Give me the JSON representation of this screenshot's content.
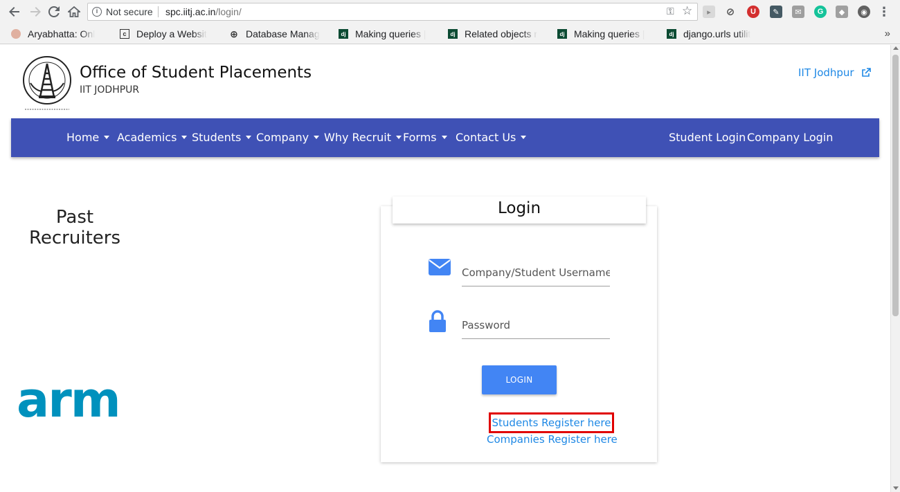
{
  "browser": {
    "security_label": "Not secure",
    "url_host": "spc.iitj.ac.in",
    "url_path": "/login/",
    "bookmarks": [
      {
        "label": "Aryabhatta: Onl",
        "icon": "aryabhatta-icon"
      },
      {
        "label": "Deploy a Websit",
        "icon": "document-icon"
      },
      {
        "label": "Database Manag",
        "icon": "globe-icon"
      },
      {
        "label": "Making queries |",
        "icon": "django-icon"
      },
      {
        "label": "Related objects r",
        "icon": "django-icon"
      },
      {
        "label": "Making queries |",
        "icon": "django-icon"
      },
      {
        "label": "django.urls utilit",
        "icon": "django-icon"
      }
    ],
    "more_bookmarks": "»"
  },
  "header": {
    "title": "Office of Student Placements",
    "subtitle": "IIT JODHPUR",
    "external_link": "IIT Jodhpur"
  },
  "nav": {
    "items": [
      {
        "label": "Home"
      },
      {
        "label": "Academics"
      },
      {
        "label": "Students"
      },
      {
        "label": "Company"
      },
      {
        "label": "Why Recruit"
      },
      {
        "label": "Forms"
      },
      {
        "label": "Contact Us"
      }
    ],
    "student_login": "Student Login",
    "company_login": "Company Login"
  },
  "sidebar": {
    "heading_line1": "Past",
    "heading_line2": "Recruiters",
    "recruiter_logo": "arm"
  },
  "login_card": {
    "title": "Login",
    "username_placeholder": "Company/Student Username",
    "password_placeholder": "Password",
    "login_button": "LOGIN",
    "students_register": "Students Register here",
    "companies_register": "Companies Register here"
  },
  "colors": {
    "navbar": "#3f51b5",
    "link": "#1e88e5",
    "button": "#4285f4",
    "icon": "#4285f4",
    "highlight": "#e00000",
    "arm": "#0091bd"
  }
}
